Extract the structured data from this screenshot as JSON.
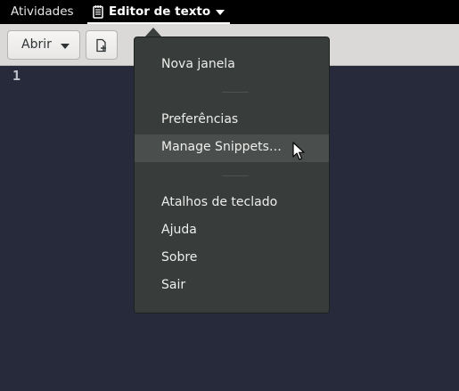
{
  "topbar": {
    "activities": "Atividades",
    "app_name": "Editor de texto",
    "app_icon": "text-editor-icon"
  },
  "headerbar": {
    "open_label": "Abrir",
    "new_icon": "new-document-icon"
  },
  "editor": {
    "line_numbers": [
      "1"
    ]
  },
  "menu": {
    "items": [
      "Nova janela",
      "Preferências",
      "Manage Snippets…",
      "Atalhos de teclado",
      "Ajuda",
      "Sobre",
      "Sair"
    ],
    "highlighted": "Manage Snippets…"
  },
  "colors": {
    "topbar": "#000000",
    "headerbar": "#dad9d7",
    "editor_bg": "#272a3a",
    "menu_bg": "#383c3a",
    "menu_hover": "#4a4e4c"
  }
}
